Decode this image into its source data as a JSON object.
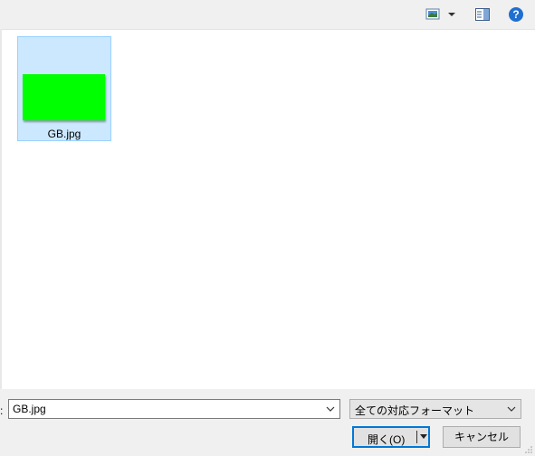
{
  "toolbar": {
    "view_icon": "view-options-icon",
    "preview_icon": "preview-pane-icon",
    "help_icon": "help-icon",
    "help_glyph": "?"
  },
  "files": [
    {
      "name": "GB.jpg",
      "thumbnail_color": "#00ff00",
      "selected": true
    }
  ],
  "filename": {
    "label_fragment": ":",
    "value": "GB.jpg"
  },
  "filetype": {
    "selected": "全ての対応フォーマット"
  },
  "buttons": {
    "open_label": "開く(O)",
    "cancel_label": "キャンセル"
  },
  "colors": {
    "accent": "#0078d7",
    "selection_bg": "#cce8ff",
    "selection_border": "#99d1ff"
  }
}
